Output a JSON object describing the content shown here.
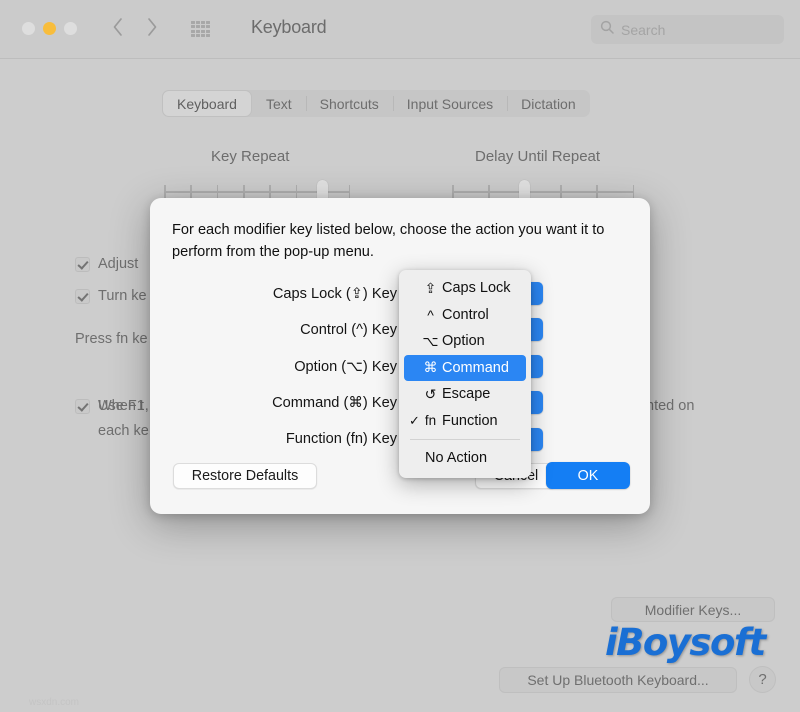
{
  "window": {
    "title": "Keyboard",
    "traffic_lights": [
      "close-button",
      "minimize-button",
      "maximize-button"
    ],
    "nav": {
      "back": "back-icon",
      "forward": "forward-icon",
      "grid": "show-all-icon"
    },
    "search": {
      "placeholder": "Search",
      "icon": "search-icon"
    }
  },
  "tabs": [
    {
      "label": "Keyboard",
      "active": true
    },
    {
      "label": "Text",
      "active": false
    },
    {
      "label": "Shortcuts",
      "active": false
    },
    {
      "label": "Input Sources",
      "active": false
    },
    {
      "label": "Dictation",
      "active": false
    }
  ],
  "sliders": {
    "key_repeat": {
      "label": "Key Repeat",
      "ticks": 8,
      "value_index": 7
    },
    "delay_until_repeat": {
      "label": "Delay Until Repeat",
      "ticks": 6,
      "value_index": 3
    }
  },
  "background_options": {
    "adjust_checkbox": {
      "label": "Adjust",
      "checked": true
    },
    "turn_checkbox": {
      "label": "Turn ke",
      "checked": true
    },
    "press_fn_text": "Press fn ke",
    "use_f1_checkbox": {
      "label": "Use F1,",
      "checked": true
    },
    "desc_line1": "When t",
    "desc_line2": "each ke",
    "desc_right_fragment": "nted on"
  },
  "bottom_buttons": {
    "modifier_keys": "Modifier Keys...",
    "bluetooth": "Set Up Bluetooth Keyboard...",
    "help": "?"
  },
  "watermarks": {
    "brand": "iBoysoft",
    "brand_color": "#1a6fd4",
    "site": "wsxdn.com"
  },
  "dialog": {
    "intro": "For each modifier key listed below, choose the action you want it to perform from the pop-up menu.",
    "rows": [
      {
        "label": "Caps Lock (⇪) Key"
      },
      {
        "label": "Control (^) Key"
      },
      {
        "label": "Option (⌥) Key"
      },
      {
        "label": "Command (⌘) Key"
      },
      {
        "label": "Function (fn) Key"
      }
    ],
    "buttons": {
      "restore": "Restore Defaults",
      "cancel": "Cancel",
      "ok": "OK"
    },
    "accent_color": "#147ef4"
  },
  "menu": {
    "items": [
      {
        "glyph": "⇪",
        "label": "Caps Lock",
        "selected": false,
        "checked": false
      },
      {
        "glyph": "^",
        "label": "Control",
        "selected": false,
        "checked": false
      },
      {
        "glyph": "⌥",
        "label": "Option",
        "selected": false,
        "checked": false
      },
      {
        "glyph": "⌘",
        "label": "Command",
        "selected": true,
        "checked": false
      },
      {
        "glyph": "↺",
        "label": "Escape",
        "selected": false,
        "checked": false
      },
      {
        "glyph": "fn",
        "label": "Function",
        "selected": false,
        "checked": true
      }
    ],
    "separator": true,
    "no_action": "No Action",
    "highlight_color": "#2b86f3"
  }
}
